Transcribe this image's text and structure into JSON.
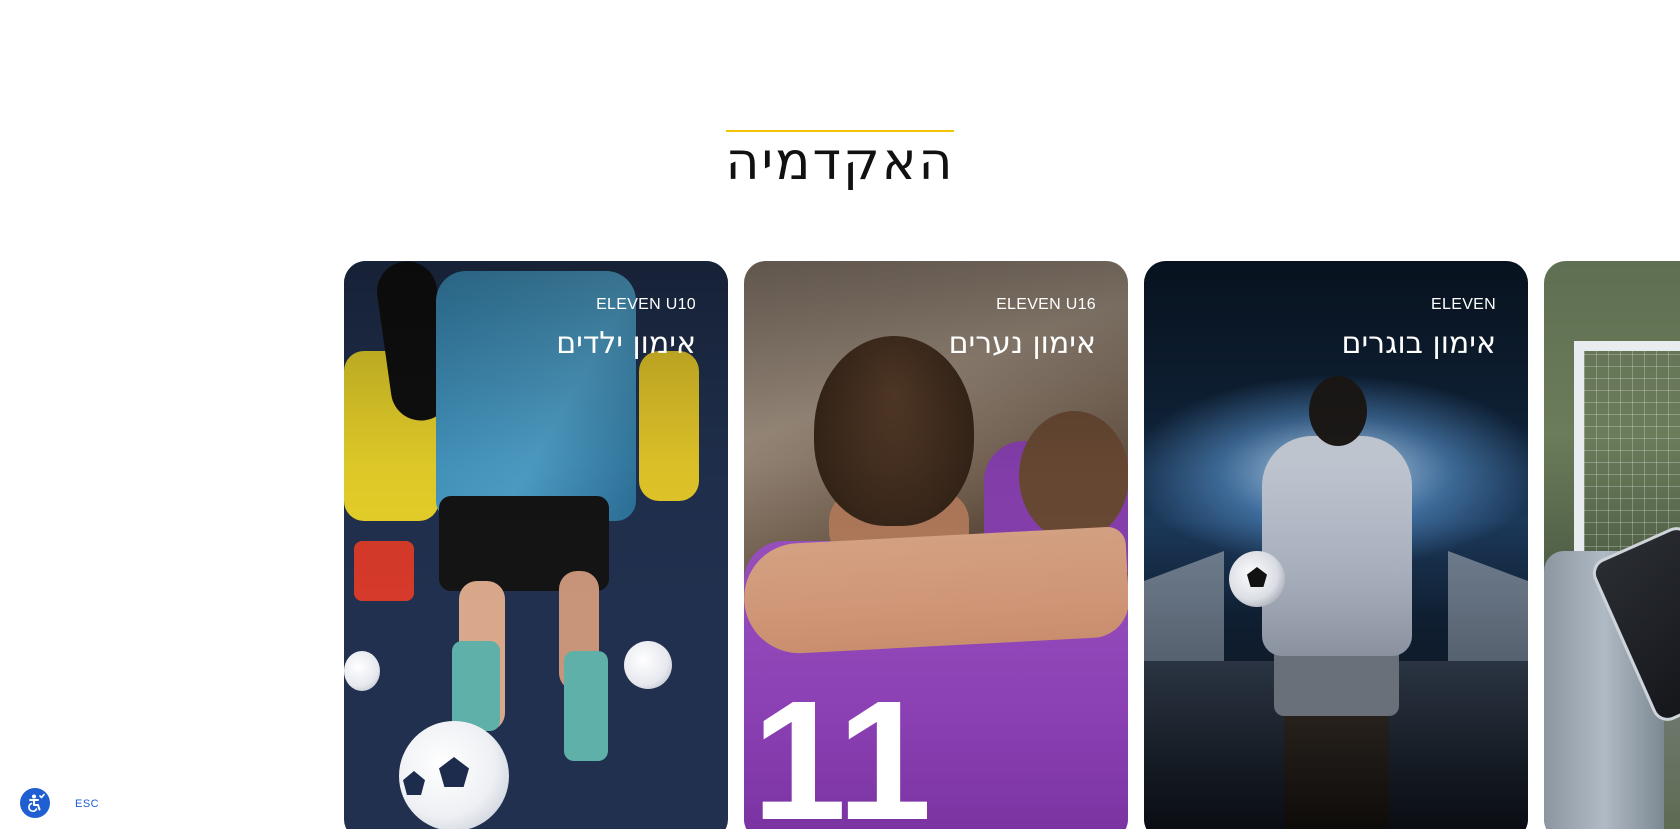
{
  "section": {
    "title": "האקדמיה"
  },
  "cards": [
    {
      "subtitle": "ELEVEN U10",
      "title": "אימון ילדים"
    },
    {
      "subtitle": "ELEVEN U16",
      "title": "אימון נערים"
    },
    {
      "subtitle": "ELEVEN",
      "title": "אימון בוגרים"
    },
    {
      "subtitle": "",
      "title": ""
    }
  ],
  "accessibility": {
    "icon": "accessibility-icon",
    "esc_label": "ESC"
  },
  "colors": {
    "accent": "#f2c300",
    "a11y_blue": "#1f5fd1"
  }
}
